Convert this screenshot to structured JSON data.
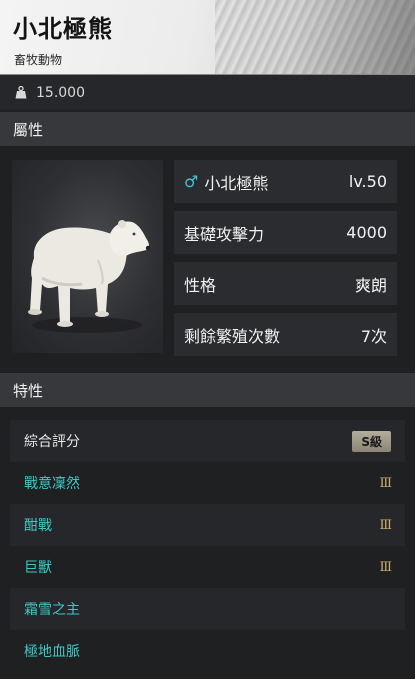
{
  "header": {
    "title": "小北極熊",
    "subtitle": "畜牧動物"
  },
  "weight": {
    "icon": "weight-icon",
    "value": "15.000"
  },
  "sections": {
    "attributes": "屬性",
    "traits": "特性"
  },
  "stats": [
    {
      "label": "小北極熊",
      "value": "lv.50",
      "gender_icon": "male-icon"
    },
    {
      "label": "基礎攻擊力",
      "value": "4000"
    },
    {
      "label": "性格",
      "value": "爽朗"
    },
    {
      "label": "剩餘繁殖次數",
      "value": "7次"
    }
  ],
  "traits": [
    {
      "name": "綜合評分",
      "badge": "S級"
    },
    {
      "name": "戰意凜然",
      "level": "Ⅲ"
    },
    {
      "name": "酣戰",
      "level": "Ⅲ"
    },
    {
      "name": "巨獸",
      "level": "Ⅲ"
    },
    {
      "name": "霜雪之主",
      "level": ""
    },
    {
      "name": "極地血脈",
      "level": ""
    }
  ],
  "colors": {
    "accent_teal": "#3fc7c4",
    "male_icon": "#3ec7d6",
    "level_gold": "#c9ad6c",
    "badge": "#a39d8b"
  }
}
